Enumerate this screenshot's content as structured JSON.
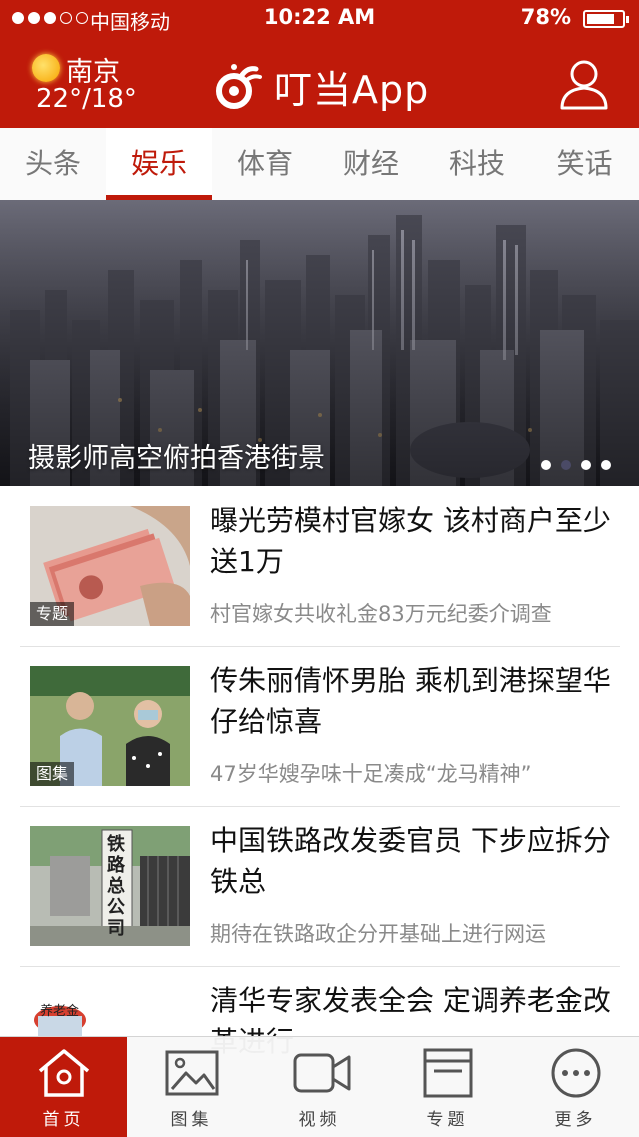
{
  "status_bar": {
    "carrier": "中国移动",
    "time": "10:22 AM",
    "battery": "78%",
    "battery_level": 0.78,
    "signal_bars": 3
  },
  "header": {
    "city": "南京",
    "temperature": "22°/18°",
    "app_name": "叮当App"
  },
  "tabs": [
    {
      "label": "头条",
      "active": false
    },
    {
      "label": "娱乐",
      "active": true
    },
    {
      "label": "体育",
      "active": false
    },
    {
      "label": "财经",
      "active": false
    },
    {
      "label": "科技",
      "active": false
    },
    {
      "label": "笑话",
      "active": false
    }
  ],
  "hero": {
    "caption": "摄影师高空俯拍香港街景",
    "page_count": 4,
    "current_page": 2
  },
  "news": [
    {
      "title": "曝光劳模村官嫁女 该村商户至少送1万",
      "summary": "村官嫁女共收礼金83万元纪委介调查",
      "badge": "专题"
    },
    {
      "title": "传朱丽倩怀男胎 乘机到港探望华仔给惊喜",
      "summary": "47岁华嫂孕味十足凑成“龙马精神”",
      "badge": "图集"
    },
    {
      "title": "中国铁路改发委官员 下步应拆分铁总",
      "summary": "期待在铁路政企分开基础上进行网运",
      "badge": ""
    },
    {
      "title": "清华专家发表全会 定调养老金改革进行",
      "summary": "",
      "badge": ""
    }
  ],
  "thumb_texts": {
    "railway_sign": "铁路总公司",
    "pension": "养老金"
  },
  "bottom_nav": [
    {
      "label": "首页",
      "icon": "home-icon",
      "active": true
    },
    {
      "label": "图集",
      "icon": "gallery-icon",
      "active": false
    },
    {
      "label": "视频",
      "icon": "video-icon",
      "active": false
    },
    {
      "label": "专题",
      "icon": "topic-icon",
      "active": false
    },
    {
      "label": "更多",
      "icon": "more-icon",
      "active": false
    }
  ],
  "colors": {
    "brand_red": "#bf1a0a",
    "text_gray": "#8a8a8a",
    "sun": "#f7a400"
  }
}
